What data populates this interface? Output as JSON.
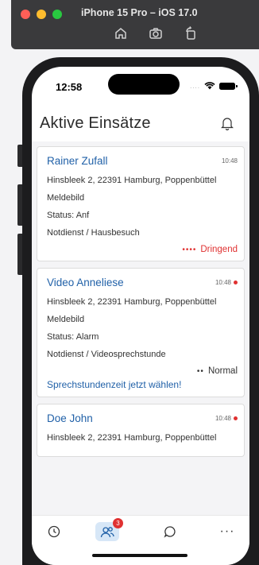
{
  "simulator": {
    "title": "iPhone 15 Pro – iOS 17.0",
    "tools": [
      "home-icon",
      "screenshot-icon",
      "rotate-icon"
    ]
  },
  "status_bar": {
    "time": "12:58",
    "signal": "....",
    "icons": [
      "wifi-icon",
      "battery-icon"
    ]
  },
  "header": {
    "title": "Aktive Einsätze",
    "icon": "bell-icon"
  },
  "cards": [
    {
      "name": "Rainer Zufall",
      "time": "10:48",
      "unread": false,
      "address": "Hinsbleek 2, 22391 Hamburg, Poppenbüttel",
      "meldebild": "Meldebild",
      "status": "Status: Anf",
      "type": "Notdienst / Hausbesuch",
      "priority_dots": "••••",
      "priority": "Dringend",
      "priority_color": "#e03131"
    },
    {
      "name": "Video Anneliese",
      "time": "10:48",
      "unread": true,
      "address": "Hinsbleek 2, 22391 Hamburg, Poppenbüttel",
      "meldebild": "Meldebild",
      "status": "Status: Alarm",
      "type": "Notdienst / Videosprechstunde",
      "priority_dots": "••",
      "priority": "Normal",
      "priority_color": "#333333",
      "cta": "Sprechstundenzeit jetzt wählen!"
    },
    {
      "name": "Doe John",
      "time": "10:48",
      "unread": true,
      "address": "Hinsbleek 2, 22391 Hamburg, Poppenbüttel"
    }
  ],
  "tabbar": {
    "tabs": [
      "clock-icon",
      "users-icon",
      "chat-icon",
      "more-icon"
    ],
    "active": "users-icon",
    "badge_count": "3",
    "more_label": "···"
  },
  "colors": {
    "accent": "#2161a8",
    "danger": "#e03131",
    "active_tab_bg": "#d7e7f7"
  }
}
